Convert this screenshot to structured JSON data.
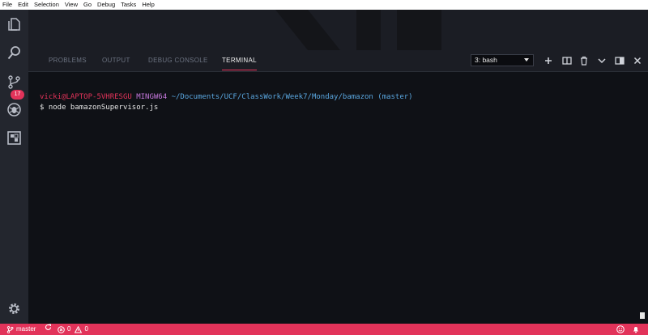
{
  "menu": {
    "items": [
      "File",
      "Edit",
      "Selection",
      "View",
      "Go",
      "Debug",
      "Tasks",
      "Help"
    ]
  },
  "activity_bar": {
    "icons": [
      "explorer-icon",
      "search-icon",
      "source-control-icon",
      "debug-icon",
      "extensions-icon",
      "gear-icon"
    ],
    "scm_badge": "17"
  },
  "panel": {
    "tabs": {
      "problems": "PROBLEMS",
      "output": "OUTPUT",
      "debug_console": "DEBUG CONSOLE",
      "terminal": "TERMINAL"
    },
    "active_tab": "TERMINAL",
    "terminal_selector": "3: bash",
    "toolbar_icons": [
      "plus-icon",
      "split-icon",
      "trash-icon",
      "chevron-down-icon",
      "maximize-icon",
      "close-icon"
    ]
  },
  "terminal": {
    "user_host": "vicki@LAPTOP-5VHRESGU",
    "shell": "MINGW64",
    "path": "~/Documents/UCF/ClassWork/Week7/Monday/bamazon",
    "branch": "(master)",
    "prompt": "$",
    "command": "node bamazonSupervisor.js"
  },
  "status_bar": {
    "branch": "master",
    "errors": "0",
    "warnings": "0"
  },
  "colors": {
    "accent": "#e2335a",
    "panel_bg": "#0f1116",
    "tab_bar_bg": "#1b1d24",
    "activity_bg": "#23262e"
  }
}
